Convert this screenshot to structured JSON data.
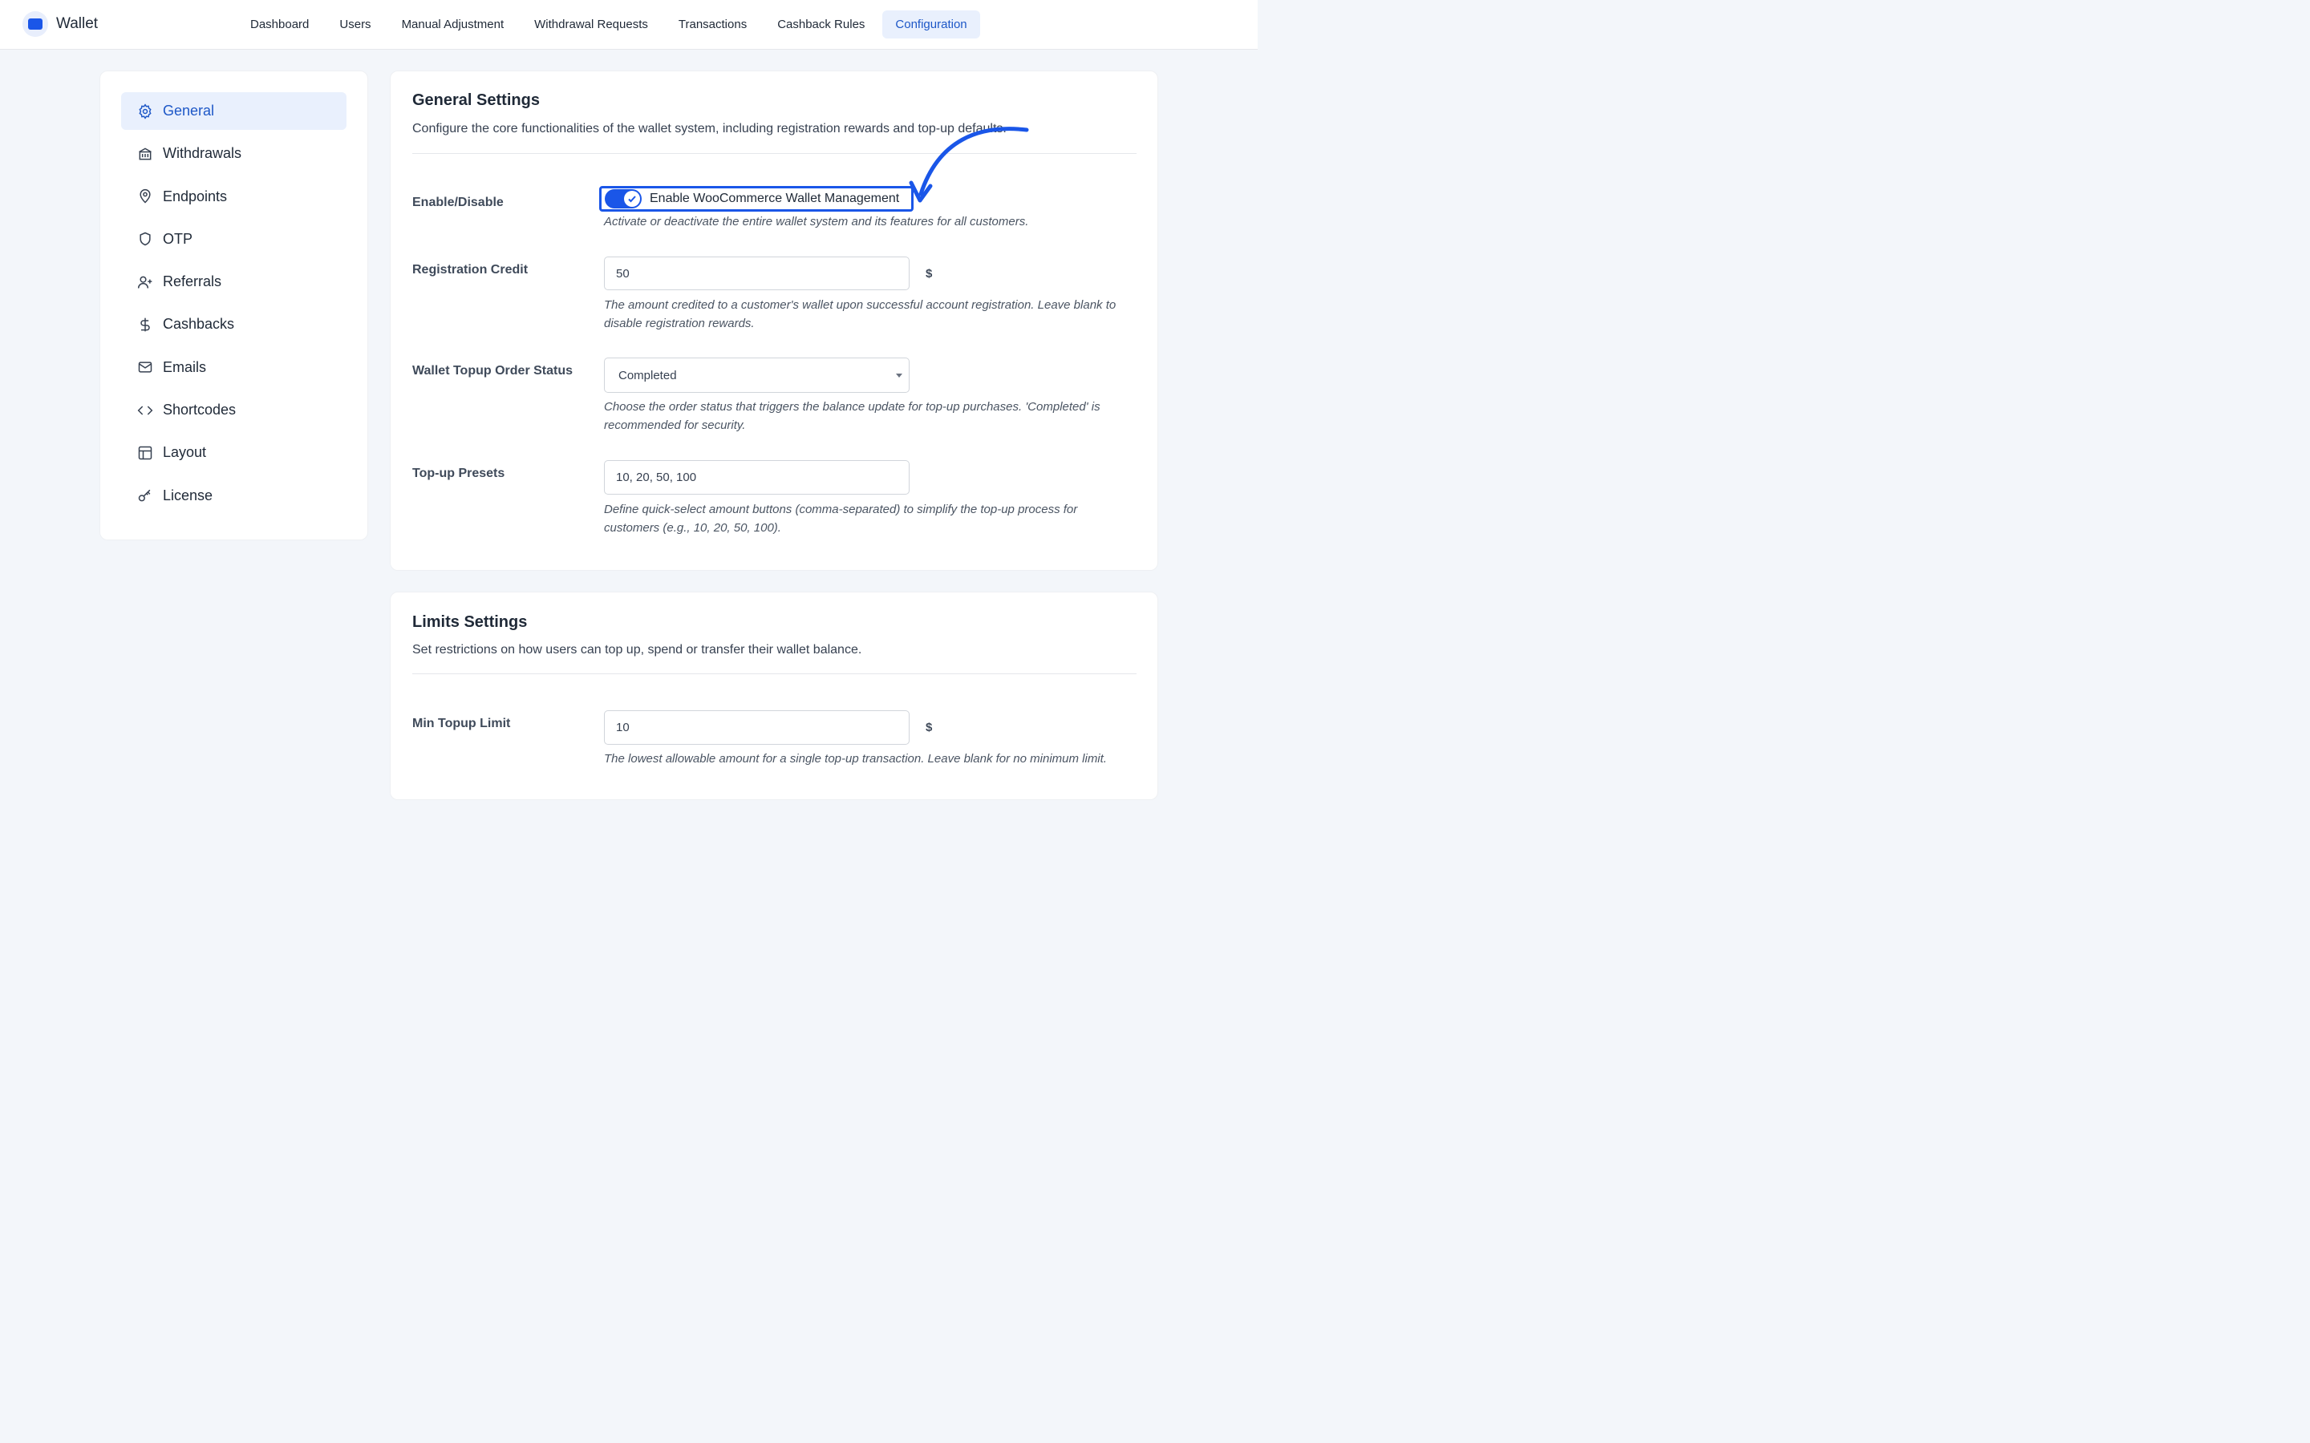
{
  "brand": {
    "name": "Wallet"
  },
  "nav": {
    "items": [
      {
        "label": "Dashboard"
      },
      {
        "label": "Users"
      },
      {
        "label": "Manual Adjustment"
      },
      {
        "label": "Withdrawal Requests"
      },
      {
        "label": "Transactions"
      },
      {
        "label": "Cashback Rules"
      },
      {
        "label": "Configuration",
        "active": true
      }
    ]
  },
  "sidebar": {
    "items": [
      {
        "label": "General",
        "icon": "gear-icon",
        "active": true
      },
      {
        "label": "Withdrawals",
        "icon": "bank-icon"
      },
      {
        "label": "Endpoints",
        "icon": "map-pin-icon"
      },
      {
        "label": "OTP",
        "icon": "shield-icon"
      },
      {
        "label": "Referrals",
        "icon": "user-plus-icon"
      },
      {
        "label": "Cashbacks",
        "icon": "dollar-icon"
      },
      {
        "label": "Emails",
        "icon": "mail-icon"
      },
      {
        "label": "Shortcodes",
        "icon": "code-icon"
      },
      {
        "label": "Layout",
        "icon": "layout-icon"
      },
      {
        "label": "License",
        "icon": "key-icon"
      }
    ]
  },
  "general": {
    "title": "General Settings",
    "description": "Configure the core functionalities of the wallet system, including registration rewards and top-up defaults.",
    "enable": {
      "label": "Enable/Disable",
      "toggle_label": "Enable WooCommerce Wallet Management",
      "checked": true,
      "help": "Activate or deactivate the entire wallet system and its features for all customers."
    },
    "registration_credit": {
      "label": "Registration Credit",
      "value": "50",
      "unit": "$",
      "help": "The amount credited to a customer's wallet upon successful account registration. Leave blank to disable registration rewards."
    },
    "topup_status": {
      "label": "Wallet Topup Order Status",
      "value": "Completed",
      "help": "Choose the order status that triggers the balance update for top-up purchases. 'Completed' is recommended for security."
    },
    "presets": {
      "label": "Top-up Presets",
      "value": "10, 20, 50, 100",
      "help": "Define quick-select amount buttons (comma-separated) to simplify the top-up process for customers (e.g., 10, 20, 50, 100)."
    }
  },
  "limits": {
    "title": "Limits Settings",
    "description": "Set restrictions on how users can top up, spend or transfer their wallet balance.",
    "min_topup": {
      "label": "Min Topup Limit",
      "value": "10",
      "unit": "$",
      "help": "The lowest allowable amount for a single top-up transaction. Leave blank for no minimum limit."
    }
  },
  "colors": {
    "accent": "#1a56e8",
    "active_bg": "#e9f0fd",
    "active_text": "#1d57c7"
  }
}
